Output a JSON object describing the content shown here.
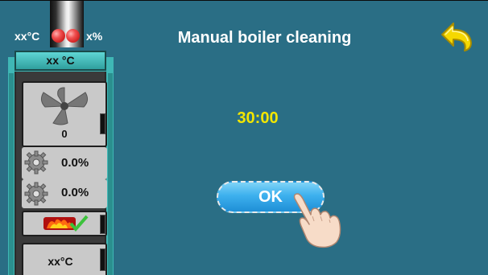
{
  "status": {
    "temp": "xx°C",
    "percent": "x%"
  },
  "boiler": {
    "top_temp": "xx °C",
    "fan_value": "0",
    "gear1_value": "0.0%",
    "gear2_value": "0.0%",
    "temp_value": "xx°C"
  },
  "screen": {
    "title": "Manual boiler cleaning",
    "timer": "30:00",
    "ok_label": "OK"
  },
  "icons": [
    "chimney-icon",
    "lamp-icon",
    "fan-icon",
    "gear-icon",
    "flame-icon",
    "back-arrow-icon",
    "hand-pointer-icon"
  ],
  "colors": {
    "background": "#2a6e85",
    "boiler": "#3fb7b5",
    "timer": "#f2e600",
    "ok_button": "#3db0ee",
    "back_arrow": "#f5d800"
  }
}
